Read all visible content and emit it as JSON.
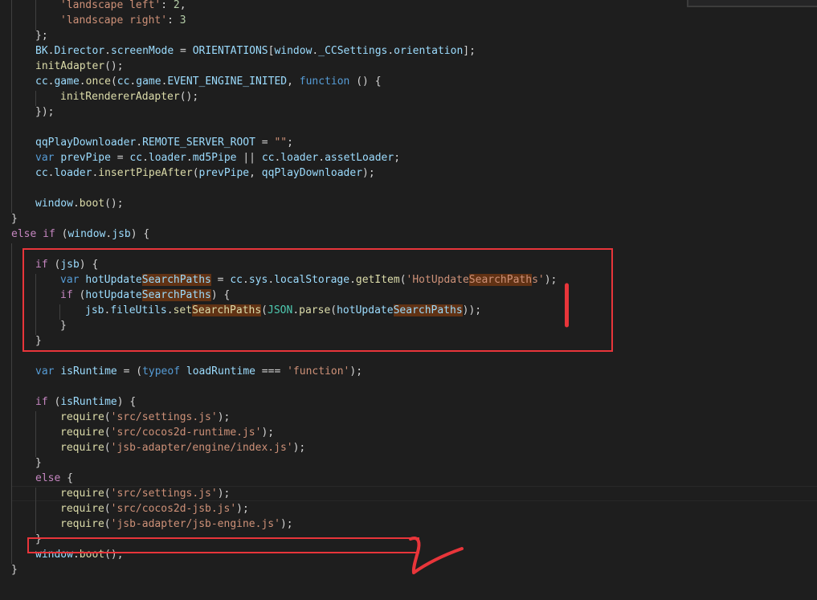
{
  "colors": {
    "background": "#1e1e1e",
    "keyword": "#569cd6",
    "control_keyword": "#c586c0",
    "string": "#ce9178",
    "variable": "#9cdcfe",
    "function": "#dcdcaa",
    "class": "#4ec9b0",
    "number": "#b5cea8",
    "annotation_red": "#e8353a",
    "search_highlight": "#613214"
  },
  "code": {
    "l01": [
      "'landscape left'",
      ": ",
      "2",
      ","
    ],
    "l02": [
      "'landscape right'",
      ": ",
      "3"
    ],
    "l03": [
      "};"
    ],
    "l04": [
      "BK",
      ".",
      "Director",
      ".",
      "screenMode",
      " = ",
      "ORIENTATIONS",
      "[",
      "window",
      ".",
      "_CCSettings",
      ".",
      "orientation",
      "];"
    ],
    "l05": [
      "initAdapter",
      "();"
    ],
    "l06": [
      "cc",
      ".",
      "game",
      ".",
      "once",
      "(",
      "cc",
      ".",
      "game",
      ".",
      "EVENT_ENGINE_INITED",
      ", ",
      "function",
      " () {"
    ],
    "l07": [
      "initRendererAdapter",
      "();"
    ],
    "l08": [
      "});"
    ],
    "l09": [
      "qqPlayDownloader",
      ".",
      "REMOTE_SERVER_ROOT",
      " = ",
      "\"\"",
      ";"
    ],
    "l10": [
      "var",
      " ",
      "prevPipe",
      " = ",
      "cc",
      ".",
      "loader",
      ".",
      "md5Pipe",
      " || ",
      "cc",
      ".",
      "loader",
      ".",
      "assetLoader",
      ";"
    ],
    "l11": [
      "cc",
      ".",
      "loader",
      ".",
      "insertPipeAfter",
      "(",
      "prevPipe",
      ", ",
      "qqPlayDownloader",
      ");"
    ],
    "l12": [
      "window",
      ".",
      "boot",
      "();"
    ],
    "l13": [
      "}"
    ],
    "l14": [
      "else",
      " ",
      "if",
      " (",
      "window",
      ".",
      "jsb",
      ") {"
    ],
    "l15": [
      "if",
      " (",
      "jsb",
      ") {"
    ],
    "l16": [
      "var",
      " ",
      "hotUpdate",
      "SearchPaths",
      " = ",
      "cc",
      ".",
      "sys",
      ".",
      "localStorage",
      ".",
      "getItem",
      "(",
      "'HotUpdate",
      "SearchPath",
      "s'",
      ");"
    ],
    "l17": [
      "if",
      " (",
      "hotUpdate",
      "SearchPaths",
      ") {"
    ],
    "l18": [
      "jsb",
      ".",
      "fileUtils",
      ".",
      "set",
      "SearchPaths",
      "(",
      "JSON",
      ".",
      "parse",
      "(",
      "hotUpdate",
      "SearchPaths",
      "));"
    ],
    "l19": [
      "}"
    ],
    "l20": [
      "}"
    ],
    "l21": [
      "var",
      " ",
      "isRuntime",
      " = (",
      "typeof",
      " ",
      "loadRuntime",
      " === ",
      "'function'",
      ");"
    ],
    "l22": [
      "if",
      " (",
      "isRuntime",
      ") {"
    ],
    "l23": [
      "require",
      "(",
      "'src/settings.js'",
      ");"
    ],
    "l24": [
      "require",
      "(",
      "'src/cocos2d-runtime.js'",
      ");"
    ],
    "l25": [
      "require",
      "(",
      "'jsb-adapter/engine/index.js'",
      ");"
    ],
    "l26": [
      "}"
    ],
    "l27": [
      "else",
      " {"
    ],
    "l28": [
      "require",
      "(",
      "'src/settings.js'",
      ");"
    ],
    "l29": [
      "require",
      "(",
      "'src/cocos2d-jsb.js'",
      ");"
    ],
    "l30": [
      "require",
      "(",
      "'jsb-adapter/jsb-engine.js'",
      ");"
    ],
    "l31": [
      "}"
    ],
    "l32": [
      "window",
      ".",
      "boot",
      "();"
    ],
    "l33": [
      "}"
    ]
  }
}
